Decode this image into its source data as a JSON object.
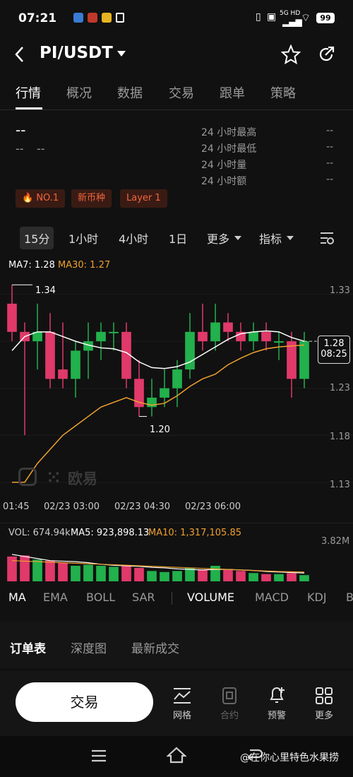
{
  "status_bar": {
    "time": "07:21",
    "battery": "99",
    "network": "5G HD"
  },
  "header": {
    "pair": "PI/USDT"
  },
  "tabs": [
    "行情",
    "概况",
    "数据",
    "交易",
    "跟单",
    "策略"
  ],
  "ticker": {
    "price": "--",
    "change_left": "--",
    "change_right": "--",
    "stats": [
      {
        "label": "24 小时最高",
        "value": "--"
      },
      {
        "label": "24 小时最低",
        "value": "--"
      },
      {
        "label": "24 小时量",
        "value": "--"
      },
      {
        "label": "24 小时额",
        "value": "--"
      }
    ]
  },
  "tags": [
    "NO.1",
    "新币种",
    "Layer 1"
  ],
  "intervals": [
    "15分",
    "1小时",
    "4小时",
    "1日",
    "更多",
    "指标"
  ],
  "chart": {
    "ma7_label": "MA7: 1.28",
    "ma30_label": "MA30: 1.27",
    "high_label": "1.34",
    "low_label": "1.20",
    "price_ticks": [
      "1.33",
      "1.28",
      "1.23",
      "1.18",
      "1.13"
    ],
    "current_price": "1.28",
    "countdown": "08:25",
    "time_ticks": [
      "01:45",
      "02/23 03:00",
      "02/23 04:30",
      "02/23 06:00"
    ],
    "watermark": "欧易",
    "colors": {
      "up": "#22b14c",
      "down": "#e0396a",
      "ma7": "#ffffff",
      "ma30": "#f0a030"
    }
  },
  "volume": {
    "vol_label": "VOL: 674.94k",
    "ma5_label": "MA5: 923,898.13",
    "ma10_label": "MA10: 1,317,105.85",
    "max_label": "3.82M"
  },
  "indicators": [
    "MA",
    "EMA",
    "BOLL",
    "SAR",
    "VOLUME",
    "MACD",
    "KDJ",
    "B"
  ],
  "order_tabs": [
    "订单表",
    "深度图",
    "最新成交"
  ],
  "bottom": {
    "trade_label": "交易",
    "nav": [
      "网格",
      "合约",
      "预警",
      "更多"
    ]
  },
  "watermark_footer": "@在你心里特色水果捞",
  "chart_data": {
    "type": "candlestick",
    "y_range": [
      1.12,
      1.35
    ],
    "candles": [
      {
        "o": 1.32,
        "h": 1.34,
        "l": 1.28,
        "c": 1.29
      },
      {
        "o": 1.29,
        "h": 1.3,
        "l": 1.18,
        "c": 1.28
      },
      {
        "o": 1.28,
        "h": 1.32,
        "l": 1.25,
        "c": 1.29
      },
      {
        "o": 1.29,
        "h": 1.31,
        "l": 1.23,
        "c": 1.24
      },
      {
        "o": 1.25,
        "h": 1.3,
        "l": 1.23,
        "c": 1.24
      },
      {
        "o": 1.24,
        "h": 1.28,
        "l": 1.22,
        "c": 1.27
      },
      {
        "o": 1.27,
        "h": 1.3,
        "l": 1.24,
        "c": 1.28
      },
      {
        "o": 1.28,
        "h": 1.3,
        "l": 1.26,
        "c": 1.29
      },
      {
        "o": 1.29,
        "h": 1.3,
        "l": 1.27,
        "c": 1.29
      },
      {
        "o": 1.29,
        "h": 1.3,
        "l": 1.23,
        "c": 1.24
      },
      {
        "o": 1.24,
        "h": 1.26,
        "l": 1.2,
        "c": 1.21
      },
      {
        "o": 1.21,
        "h": 1.24,
        "l": 1.2,
        "c": 1.22
      },
      {
        "o": 1.22,
        "h": 1.25,
        "l": 1.21,
        "c": 1.23
      },
      {
        "o": 1.23,
        "h": 1.26,
        "l": 1.21,
        "c": 1.25
      },
      {
        "o": 1.25,
        "h": 1.31,
        "l": 1.24,
        "c": 1.29
      },
      {
        "o": 1.29,
        "h": 1.32,
        "l": 1.27,
        "c": 1.28
      },
      {
        "o": 1.28,
        "h": 1.32,
        "l": 1.27,
        "c": 1.3
      },
      {
        "o": 1.3,
        "h": 1.31,
        "l": 1.28,
        "c": 1.29
      },
      {
        "o": 1.29,
        "h": 1.3,
        "l": 1.27,
        "c": 1.28
      },
      {
        "o": 1.28,
        "h": 1.3,
        "l": 1.27,
        "c": 1.29
      },
      {
        "o": 1.29,
        "h": 1.3,
        "l": 1.27,
        "c": 1.28
      },
      {
        "o": 1.28,
        "h": 1.29,
        "l": 1.26,
        "c": 1.28
      },
      {
        "o": 1.28,
        "h": 1.29,
        "l": 1.22,
        "c": 1.24
      },
      {
        "o": 1.24,
        "h": 1.29,
        "l": 1.23,
        "c": 1.28
      }
    ],
    "ma7": [
      1.27,
      1.285,
      1.29,
      1.29,
      1.285,
      1.28,
      1.276,
      1.273,
      1.272,
      1.268,
      1.258,
      1.252,
      1.251,
      1.253,
      1.258,
      1.266,
      1.274,
      1.282,
      1.288,
      1.29,
      1.291,
      1.29,
      1.284,
      1.28
    ],
    "ma30": [
      1.13,
      1.13,
      1.15,
      1.165,
      1.18,
      1.19,
      1.2,
      1.21,
      1.215,
      1.22,
      1.215,
      1.212,
      1.214,
      1.222,
      1.232,
      1.24,
      1.245,
      1.255,
      1.262,
      1.268,
      1.272,
      1.274,
      1.275,
      1.276
    ],
    "volume_max": 3.82,
    "volume": [
      2.4,
      2.5,
      2.1,
      2.0,
      1.8,
      1.5,
      1.6,
      1.5,
      1.4,
      1.5,
      1.3,
      1.0,
      0.9,
      1.0,
      1.3,
      1.1,
      1.5,
      1.1,
      1.0,
      0.8,
      0.7,
      0.7,
      0.8,
      0.6
    ],
    "vol_ma5": [
      2.6,
      2.4,
      2.2,
      2.0,
      1.95,
      1.9,
      1.8,
      1.65,
      1.55,
      1.5,
      1.45,
      1.35,
      1.3,
      1.2,
      1.15,
      1.1,
      1.15,
      1.15,
      1.1,
      1.05,
      0.95,
      0.9,
      0.85,
      0.8
    ],
    "vol_ma10": [
      2.0,
      1.95,
      1.9,
      1.85,
      1.8,
      1.75,
      1.7,
      1.65,
      1.6,
      1.55,
      1.5,
      1.45,
      1.4,
      1.35,
      1.3,
      1.25,
      1.2,
      1.15,
      1.1,
      1.05,
      1.0,
      0.95,
      0.92,
      0.9
    ]
  }
}
